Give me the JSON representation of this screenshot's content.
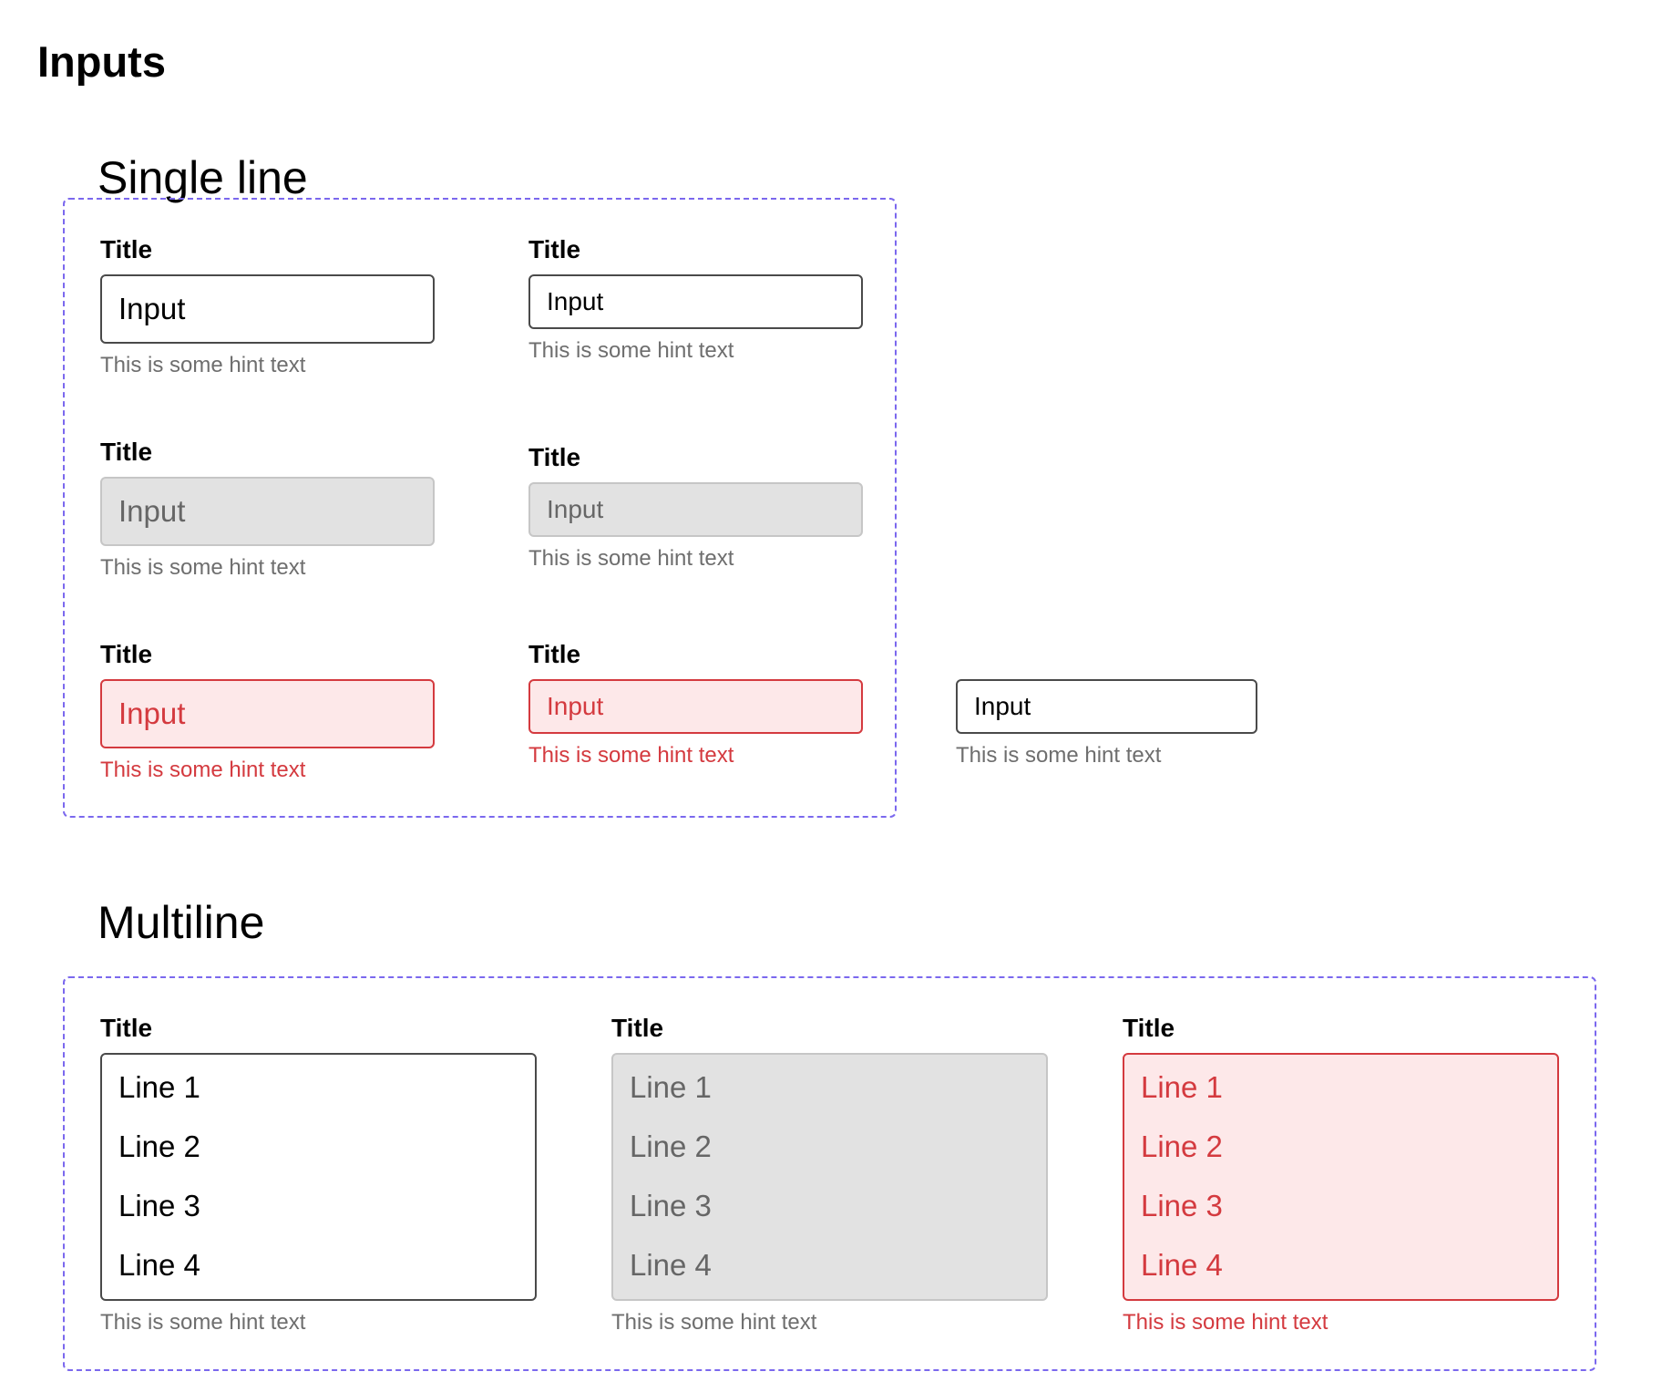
{
  "page_title": "Inputs",
  "single_line": {
    "section_title": "Single line",
    "fields": [
      {
        "title": "Title",
        "value": "Input",
        "hint": "This is some hint text"
      },
      {
        "title": "Title",
        "value": "Input",
        "hint": "This is some hint text"
      },
      {
        "title": "Title",
        "value": "Input",
        "hint": "This is some hint text"
      },
      {
        "title": "Title",
        "value": "Input",
        "hint": "This is some hint text"
      },
      {
        "title": "Title",
        "value": "Input",
        "hint": "This is some hint text"
      },
      {
        "title": "Title",
        "value": "Input",
        "hint": "This is some hint text"
      },
      {
        "value": "Input",
        "hint": "This is some hint text"
      }
    ]
  },
  "multiline": {
    "section_title": "Multiline",
    "fields": [
      {
        "title": "Title",
        "lines": [
          "Line 1",
          "Line 2",
          "Line 3",
          "Line 4"
        ],
        "hint": "This is some hint text"
      },
      {
        "title": "Title",
        "lines": [
          "Line 1",
          "Line 2",
          "Line 3",
          "Line 4"
        ],
        "hint": "This is some hint text"
      },
      {
        "title": "Title",
        "lines": [
          "Line 1",
          "Line 2",
          "Line 3",
          "Line 4"
        ],
        "hint": "This is some hint text"
      }
    ]
  },
  "colors": {
    "frame_border": "#7b68ee",
    "error": "#d43a3f",
    "error_background": "#fde8e9",
    "disabled_background": "#e2e2e2",
    "hint": "#6e6e6e"
  }
}
